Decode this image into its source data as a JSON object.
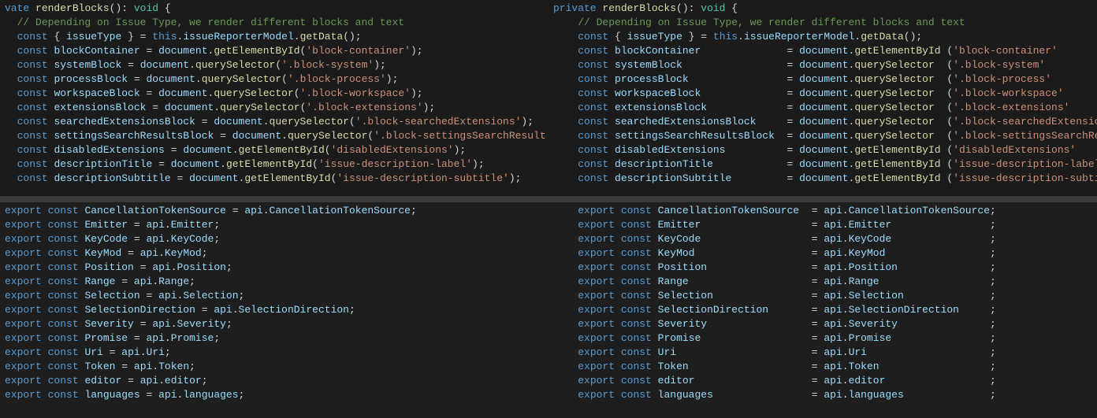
{
  "block1": {
    "sig_kw1": "vate",
    "sig_kw1_full": "private",
    "sig_fn": "renderBlocks",
    "sig_void": "void",
    "comment": "// Depending on Issue Type, we render different blocks and text",
    "destruct_line": {
      "const": "const",
      "lbrace": "{",
      "var": "issueType",
      "rbrace": "}",
      "eq": "=",
      "this": "this",
      "dot": ".",
      "member": "issueReporterModel",
      "meth": "getData",
      "paren": "()",
      "semi": ";"
    },
    "assigns": [
      {
        "var": "blockContainer",
        "recv": "document",
        "meth": "getElementById",
        "arg": "'block-container'"
      },
      {
        "var": "systemBlock",
        "recv": "document",
        "meth": "querySelector",
        "arg": "'.block-system'"
      },
      {
        "var": "processBlock",
        "recv": "document",
        "meth": "querySelector",
        "arg": "'.block-process'"
      },
      {
        "var": "workspaceBlock",
        "recv": "document",
        "meth": "querySelector",
        "arg": "'.block-workspace'"
      },
      {
        "var": "extensionsBlock",
        "recv": "document",
        "meth": "querySelector",
        "arg": "'.block-extensions'"
      },
      {
        "var": "searchedExtensionsBlock",
        "recv": "document",
        "meth": "querySelector",
        "arg": "'.block-searchedExtensions'"
      },
      {
        "var": "settingsSearchResultsBlock",
        "recv": "document",
        "meth": "querySelector",
        "arg": "'.block-settingsSearchResults'",
        "left_trunc": true
      },
      {
        "var": "disabledExtensions",
        "recv": "document",
        "meth": "getElementById",
        "arg": "'disabledExtensions'"
      },
      {
        "var": "descriptionTitle",
        "recv": "document",
        "meth": "getElementById",
        "arg": "'issue-description-label'"
      },
      {
        "var": "descriptionSubtitle",
        "recv": "document",
        "meth": "getElementById",
        "arg": "'issue-description-subtitle'"
      }
    ],
    "align": {
      "var_width": 27,
      "recv_meth_width": "getElementById",
      "space_before_open": true
    }
  },
  "block2": {
    "assigns": [
      {
        "var": "CancellationTokenSource",
        "rhs": "api.CancellationTokenSource"
      },
      {
        "var": "Emitter",
        "rhs": "api.Emitter"
      },
      {
        "var": "KeyCode",
        "rhs": "api.KeyCode"
      },
      {
        "var": "KeyMod",
        "rhs": "api.KeyMod"
      },
      {
        "var": "Position",
        "rhs": "api.Position"
      },
      {
        "var": "Range",
        "rhs": "api.Range"
      },
      {
        "var": "Selection",
        "rhs": "api.Selection"
      },
      {
        "var": "SelectionDirection",
        "rhs": "api.SelectionDirection"
      },
      {
        "var": "Severity",
        "rhs": "api.Severity"
      },
      {
        "var": "Promise",
        "rhs": "api.Promise"
      },
      {
        "var": "Uri",
        "rhs": "api.Uri"
      },
      {
        "var": "Token",
        "rhs": "api.Token"
      },
      {
        "var": "editor",
        "rhs": "api.editor"
      },
      {
        "var": "languages",
        "rhs": "api.languages"
      }
    ],
    "align": {
      "var_width": 24,
      "rhs_width": 27
    },
    "export_kw": "export",
    "const_kw": "const",
    "eq": "=",
    "semi": ";"
  }
}
